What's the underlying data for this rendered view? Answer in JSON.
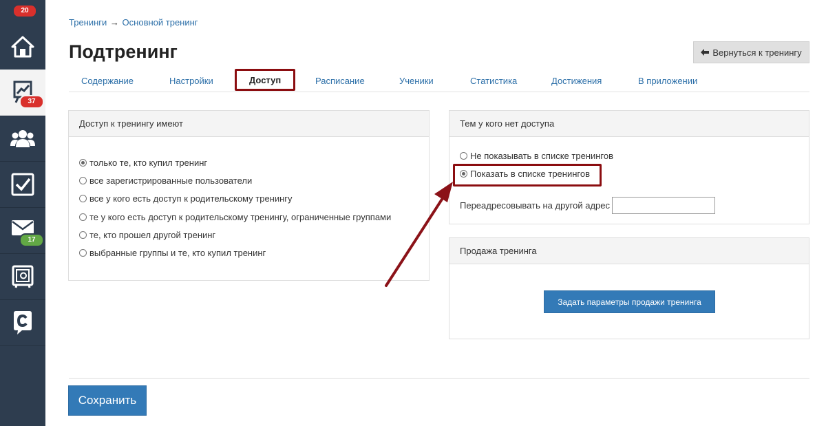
{
  "sidebar": {
    "top_badge": "20",
    "items": [
      {
        "icon": "home-icon"
      },
      {
        "icon": "chart-icon",
        "badge": "37",
        "badge_color": "#d9302c",
        "active": true
      },
      {
        "icon": "users-icon"
      },
      {
        "icon": "checkbox-icon"
      },
      {
        "icon": "mail-icon",
        "badge": "17",
        "badge_color": "#62a845"
      },
      {
        "icon": "safe-icon"
      },
      {
        "icon": "chat-logo-icon"
      }
    ]
  },
  "breadcrumb": {
    "item1": "Тренинги",
    "separator": "→",
    "item2": "Основной тренинг"
  },
  "page": {
    "title": "Подтренинг"
  },
  "back_button": {
    "icon": "arrow-left-icon",
    "label": "Вернуться к тренингу"
  },
  "tabs": [
    {
      "label": "Содержание"
    },
    {
      "label": "Настройки"
    },
    {
      "label": "Доступ",
      "active": true
    },
    {
      "label": "Расписание"
    },
    {
      "label": "Ученики"
    },
    {
      "label": "Статистика"
    },
    {
      "label": "Достижения"
    },
    {
      "label": "В приложении"
    }
  ],
  "access_panel": {
    "title": "Доступ к тренингу имеют",
    "options": [
      {
        "label": "только те, кто купил тренинг",
        "checked": true
      },
      {
        "label": "все зарегистрированные пользователи",
        "checked": false
      },
      {
        "label": "все у кого есть доступ к родительскому тренингу",
        "checked": false
      },
      {
        "label": "те у кого есть доступ к родительскому тренингу, ограниченные группами",
        "checked": false
      },
      {
        "label": "те, кто прошел другой тренинг",
        "checked": false
      },
      {
        "label": "выбранные группы и те, кто купил тренинг",
        "checked": false
      }
    ]
  },
  "no_access_panel": {
    "title": "Тем у кого нет доступа",
    "options": [
      {
        "label": "Не показывать в списке тренингов",
        "checked": false
      },
      {
        "label": "Показать в списке тренингов",
        "checked": true
      }
    ],
    "redirect_label": "Переадресовывать на другой адрес",
    "redirect_value": ""
  },
  "sale_panel": {
    "title": "Продажа тренинга",
    "button_label": "Задать параметры продажи тренинга"
  },
  "save_button": {
    "label": "Сохранить"
  },
  "colors": {
    "sidebar_bg": "#2e3d4f",
    "link": "#2c6fa8",
    "primary": "#337ab7",
    "highlight": "#8b0d10"
  }
}
